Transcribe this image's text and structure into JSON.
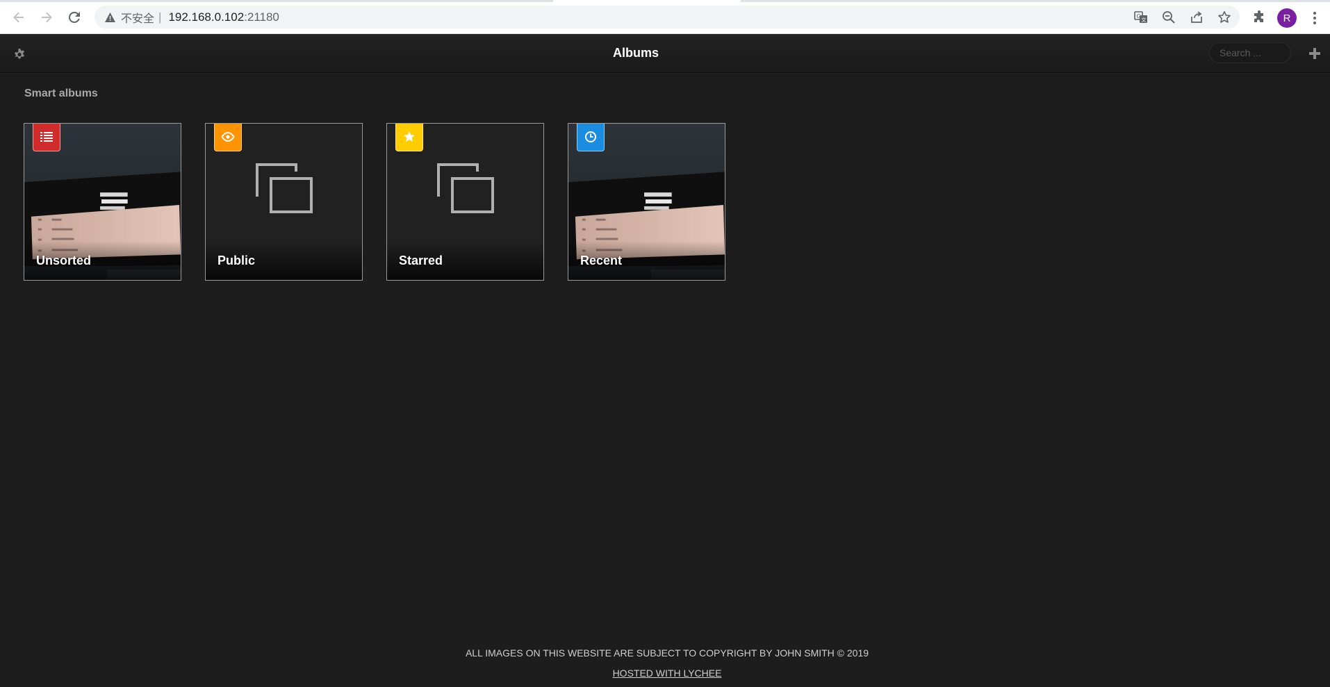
{
  "browser": {
    "insecure_label": "不安全",
    "separator": "|",
    "url_host": "192.168.0.102",
    "url_port": ":21180",
    "profile_initial": "R"
  },
  "header": {
    "title": "Albums",
    "search_placeholder": "Search ..."
  },
  "section": {
    "title": "Smart albums"
  },
  "albums": [
    {
      "label": "Unsorted",
      "badge_color": "#d12b2b",
      "icon": "list-icon",
      "thumb": "photo"
    },
    {
      "label": "Public",
      "badge_color": "#ff9300",
      "icon": "eye-icon",
      "thumb": "placeholder"
    },
    {
      "label": "Starred",
      "badge_color": "#ffcc00",
      "icon": "star-icon",
      "thumb": "placeholder"
    },
    {
      "label": "Recent",
      "badge_color": "#1a8de0",
      "icon": "clock-icon",
      "thumb": "photo"
    }
  ],
  "footer": {
    "copyright": "ALL IMAGES ON THIS WEBSITE ARE SUBJECT TO COPYRIGHT BY JOHN SMITH © 2019",
    "hosted": "HOSTED WITH LYCHEE"
  },
  "colors": {
    "background": "#1d1d1d",
    "header_text": "#ffffff",
    "section_text": "#a9a9a9"
  }
}
